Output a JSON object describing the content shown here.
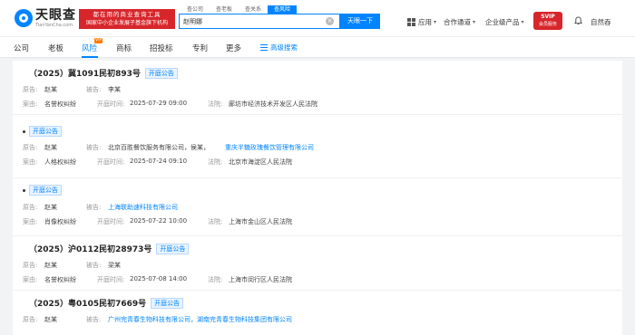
{
  "header": {
    "logo_cn": "天眼查",
    "logo_en": "TianYanCha.com",
    "promo_line1": "都在用的商业查询工具",
    "promo_line2": "国家中小企业发展子基金旗下机构",
    "search_tabs": [
      "查公司",
      "查老板",
      "查关系",
      "查风险"
    ],
    "search_value": "赵明娜",
    "search_button": "天眼一下",
    "nav_app": "应用",
    "nav_partner": "合作通道",
    "nav_enterprise": "企业级产品",
    "svip_line1": "SVIP",
    "svip_line2": "会员服务",
    "user_name": "自然吞"
  },
  "nav": {
    "items": [
      "公司",
      "老板",
      "风险",
      "商标",
      "招投标",
      "专利",
      "更多"
    ],
    "vip_badge": "VIP",
    "advanced_search": "高级搜索"
  },
  "labels": {
    "plaintiff": "原告:",
    "defendant": "被告:",
    "cause": "案由:",
    "hearing_time": "开庭时间:",
    "court": "法院:"
  },
  "cases": [
    {
      "title": "（2025）冀1091民初893号",
      "tag": "开庭公告",
      "plaintiff": "赵某",
      "defendant": "李某",
      "cause": "名誉权纠纷",
      "time": "2025-07-29 09:00",
      "court": "廊坊市经济技术开发区人民法院"
    },
    {
      "title": "",
      "tag": "开庭公告",
      "plaintiff": "赵某",
      "defendant_plain": "北京百胜餐饮服务有限公司，侯某，",
      "defendant_link": "重庆半糖玫瑰餐饮管理有限公司",
      "cause": "人格权纠纷",
      "time": "2025-07-24 09:10",
      "court": "北京市海淀区人民法院"
    },
    {
      "title": "",
      "tag": "开庭公告",
      "plaintiff": "赵某",
      "defendant_link": "上海联助速科技有限公司",
      "cause": "肖像权纠纷",
      "time": "2025-07-22 10:00",
      "court": "上海市金山区人民法院"
    },
    {
      "title": "（2025）沪0112民初28973号",
      "tag": "开庭公告",
      "plaintiff": "赵某",
      "defendant": "梁某",
      "cause": "名誉权纠纷",
      "time": "2025-07-08 14:00",
      "court": "上海市闵行区人民法院"
    },
    {
      "title": "（2025）粤0105民初7669号",
      "tag": "开庭公告",
      "plaintiff": "赵某",
      "defendant_link": "广州完青春生物科技有限公司，湖南完青春生物科技集团有限公司",
      "cause": "",
      "time": "",
      "court": ""
    }
  ]
}
